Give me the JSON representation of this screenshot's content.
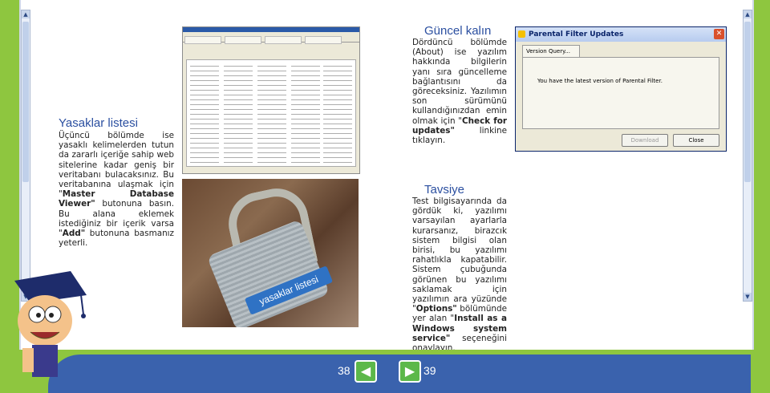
{
  "pages": {
    "left": "38",
    "right": "39"
  },
  "left_section": {
    "title": "Yasaklar listesi",
    "p1": "Üçüncü bölümde ise yasaklı kelimelerden tutun da zararlı içeriğe sahip web sitelerine kadar geniş bir veritabanı bulacaksınız. Bu veritabanına ulaşmak için \"",
    "b1": "Master Database Viewer\"",
    "p2": " butonuna basın. Bu alana eklemek istediğiniz bir içerik varsa \"",
    "b2": "Add\"",
    "p3": " butonuna basmanız yeterli."
  },
  "update_section": {
    "title": "Güncel kalın",
    "p1": "Dördüncü bölümde (About) ise yazılım hakkında bilgilerin yanı sıra güncelleme bağlantısını da göreceksiniz. Yazılımın son sürümünü kullandığınızdan emin olmak için \"",
    "b1": "Check for updates\"",
    "p2": " linkine tıklayın."
  },
  "tip_section": {
    "title": "Tavsiye",
    "p1": "Test bilgisayarında da gördük ki, yazılımı varsayılan ayarlarla kurarsanız, birazcık sistem bilgisi olan birisi, bu yazılımı rahatlıkla kapatabilir. Sistem çubuğunda görünen bu yazılımı saklamak için yazılımın ara yüzünde \"",
    "b1": "Options\"",
    "p2": " bölümünde yer alan \"",
    "b2": "Install as a Windows system service\"",
    "p3": " seçeneğini onaylayın."
  },
  "dialog": {
    "title": "Parental Filter Updates",
    "tab": "Version Query...",
    "message": "You have the latest version of Parental Filter.",
    "download": "Download",
    "close": "Close"
  },
  "lock_label": "yasaklar listesi",
  "colors": {
    "background": "#8ec63f",
    "footer": "#3a62ad",
    "heading": "#2b4fa0"
  },
  "icons": {
    "prev": "arrow-left-icon",
    "next": "arrow-right-icon"
  }
}
